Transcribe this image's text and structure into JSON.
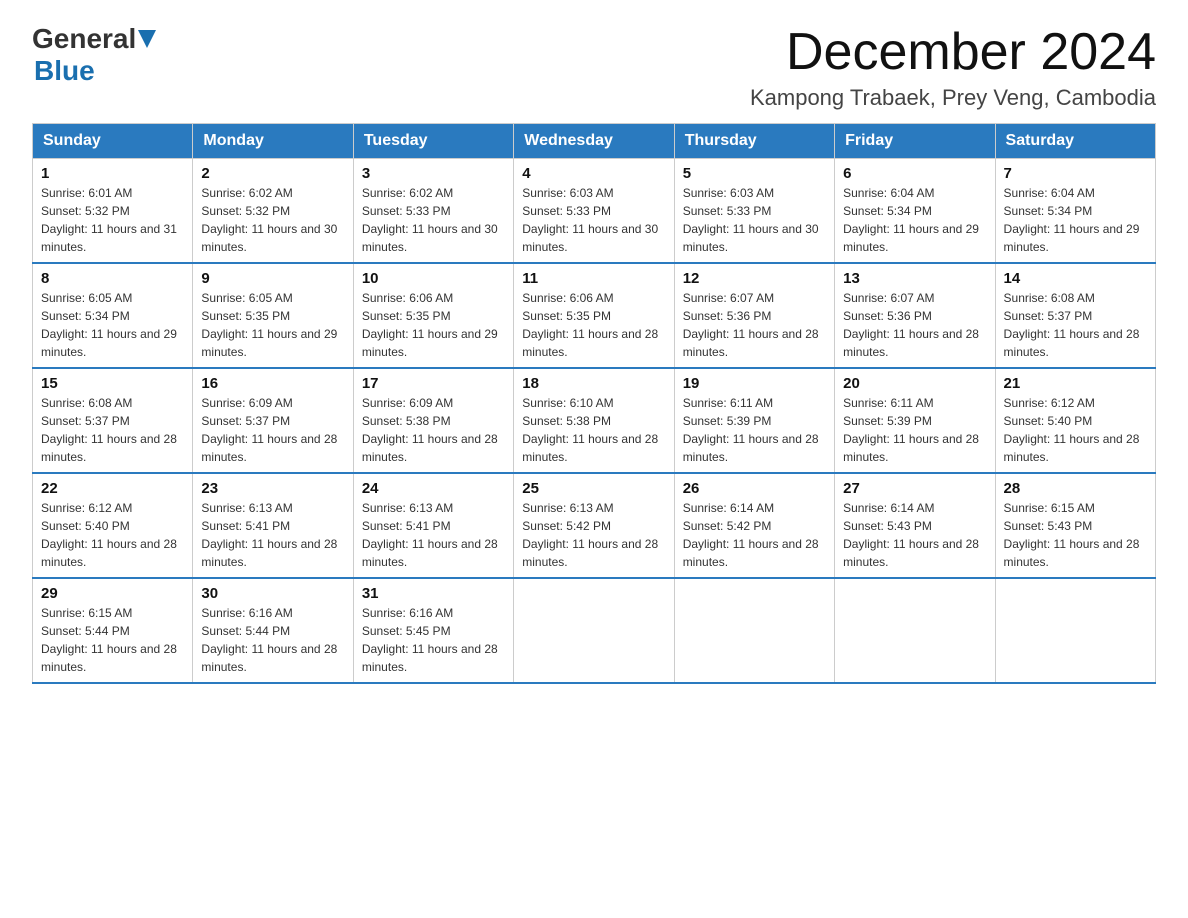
{
  "logo": {
    "line1": "General",
    "arrow": true,
    "line2": "Blue"
  },
  "title": "December 2024",
  "subtitle": "Kampong Trabaek, Prey Veng, Cambodia",
  "days_of_week": [
    "Sunday",
    "Monday",
    "Tuesday",
    "Wednesday",
    "Thursday",
    "Friday",
    "Saturday"
  ],
  "weeks": [
    [
      {
        "day": "1",
        "sunrise": "6:01 AM",
        "sunset": "5:32 PM",
        "daylight": "11 hours and 31 minutes."
      },
      {
        "day": "2",
        "sunrise": "6:02 AM",
        "sunset": "5:32 PM",
        "daylight": "11 hours and 30 minutes."
      },
      {
        "day": "3",
        "sunrise": "6:02 AM",
        "sunset": "5:33 PM",
        "daylight": "11 hours and 30 minutes."
      },
      {
        "day": "4",
        "sunrise": "6:03 AM",
        "sunset": "5:33 PM",
        "daylight": "11 hours and 30 minutes."
      },
      {
        "day": "5",
        "sunrise": "6:03 AM",
        "sunset": "5:33 PM",
        "daylight": "11 hours and 30 minutes."
      },
      {
        "day": "6",
        "sunrise": "6:04 AM",
        "sunset": "5:34 PM",
        "daylight": "11 hours and 29 minutes."
      },
      {
        "day": "7",
        "sunrise": "6:04 AM",
        "sunset": "5:34 PM",
        "daylight": "11 hours and 29 minutes."
      }
    ],
    [
      {
        "day": "8",
        "sunrise": "6:05 AM",
        "sunset": "5:34 PM",
        "daylight": "11 hours and 29 minutes."
      },
      {
        "day": "9",
        "sunrise": "6:05 AM",
        "sunset": "5:35 PM",
        "daylight": "11 hours and 29 minutes."
      },
      {
        "day": "10",
        "sunrise": "6:06 AM",
        "sunset": "5:35 PM",
        "daylight": "11 hours and 29 minutes."
      },
      {
        "day": "11",
        "sunrise": "6:06 AM",
        "sunset": "5:35 PM",
        "daylight": "11 hours and 28 minutes."
      },
      {
        "day": "12",
        "sunrise": "6:07 AM",
        "sunset": "5:36 PM",
        "daylight": "11 hours and 28 minutes."
      },
      {
        "day": "13",
        "sunrise": "6:07 AM",
        "sunset": "5:36 PM",
        "daylight": "11 hours and 28 minutes."
      },
      {
        "day": "14",
        "sunrise": "6:08 AM",
        "sunset": "5:37 PM",
        "daylight": "11 hours and 28 minutes."
      }
    ],
    [
      {
        "day": "15",
        "sunrise": "6:08 AM",
        "sunset": "5:37 PM",
        "daylight": "11 hours and 28 minutes."
      },
      {
        "day": "16",
        "sunrise": "6:09 AM",
        "sunset": "5:37 PM",
        "daylight": "11 hours and 28 minutes."
      },
      {
        "day": "17",
        "sunrise": "6:09 AM",
        "sunset": "5:38 PM",
        "daylight": "11 hours and 28 minutes."
      },
      {
        "day": "18",
        "sunrise": "6:10 AM",
        "sunset": "5:38 PM",
        "daylight": "11 hours and 28 minutes."
      },
      {
        "day": "19",
        "sunrise": "6:11 AM",
        "sunset": "5:39 PM",
        "daylight": "11 hours and 28 minutes."
      },
      {
        "day": "20",
        "sunrise": "6:11 AM",
        "sunset": "5:39 PM",
        "daylight": "11 hours and 28 minutes."
      },
      {
        "day": "21",
        "sunrise": "6:12 AM",
        "sunset": "5:40 PM",
        "daylight": "11 hours and 28 minutes."
      }
    ],
    [
      {
        "day": "22",
        "sunrise": "6:12 AM",
        "sunset": "5:40 PM",
        "daylight": "11 hours and 28 minutes."
      },
      {
        "day": "23",
        "sunrise": "6:13 AM",
        "sunset": "5:41 PM",
        "daylight": "11 hours and 28 minutes."
      },
      {
        "day": "24",
        "sunrise": "6:13 AM",
        "sunset": "5:41 PM",
        "daylight": "11 hours and 28 minutes."
      },
      {
        "day": "25",
        "sunrise": "6:13 AM",
        "sunset": "5:42 PM",
        "daylight": "11 hours and 28 minutes."
      },
      {
        "day": "26",
        "sunrise": "6:14 AM",
        "sunset": "5:42 PM",
        "daylight": "11 hours and 28 minutes."
      },
      {
        "day": "27",
        "sunrise": "6:14 AM",
        "sunset": "5:43 PM",
        "daylight": "11 hours and 28 minutes."
      },
      {
        "day": "28",
        "sunrise": "6:15 AM",
        "sunset": "5:43 PM",
        "daylight": "11 hours and 28 minutes."
      }
    ],
    [
      {
        "day": "29",
        "sunrise": "6:15 AM",
        "sunset": "5:44 PM",
        "daylight": "11 hours and 28 minutes."
      },
      {
        "day": "30",
        "sunrise": "6:16 AM",
        "sunset": "5:44 PM",
        "daylight": "11 hours and 28 minutes."
      },
      {
        "day": "31",
        "sunrise": "6:16 AM",
        "sunset": "5:45 PM",
        "daylight": "11 hours and 28 minutes."
      },
      null,
      null,
      null,
      null
    ]
  ]
}
